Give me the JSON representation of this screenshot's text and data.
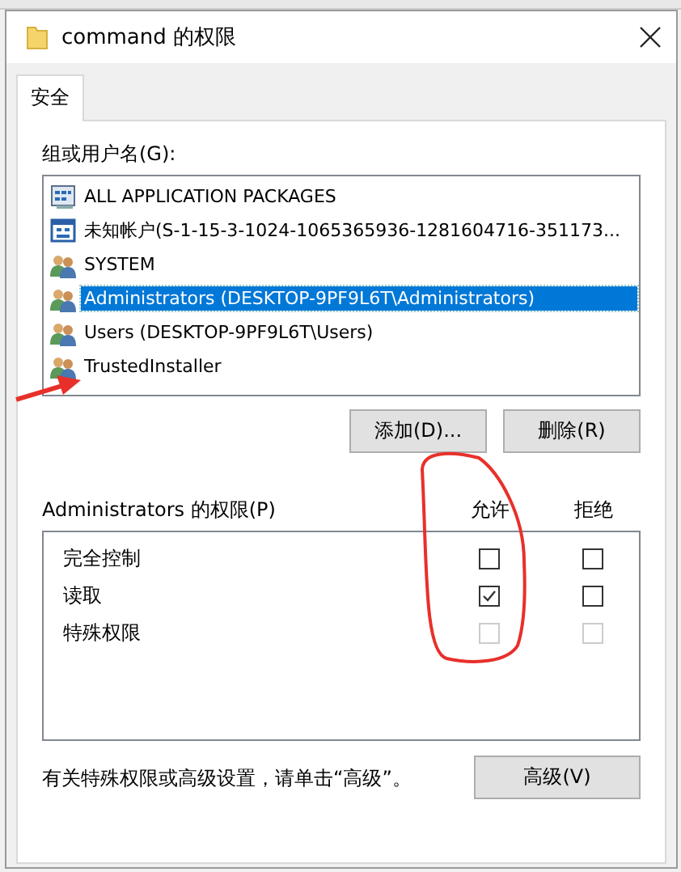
{
  "window": {
    "title": "command 的权限"
  },
  "tabs": [
    {
      "label": "安全",
      "selected": true
    }
  ],
  "users": {
    "label": "组或用户名(G):",
    "items": [
      {
        "name": "ALL APPLICATION PACKAGES",
        "kind": "packages",
        "selected": false
      },
      {
        "name": "未知帐户(S-1-15-3-1024-1065365936-1281604716-351173...",
        "kind": "account",
        "selected": false
      },
      {
        "name": "SYSTEM",
        "kind": "group",
        "selected": false
      },
      {
        "name": "Administrators (DESKTOP-9PF9L6T\\Administrators)",
        "kind": "group",
        "selected": true
      },
      {
        "name": "Users (DESKTOP-9PF9L6T\\Users)",
        "kind": "group",
        "selected": false
      },
      {
        "name": "TrustedInstaller",
        "kind": "group",
        "selected": false
      }
    ]
  },
  "buttons": [
    {
      "label": "添加(D)..."
    },
    {
      "label": "删除(R)"
    }
  ],
  "permissions": {
    "label": "Administrators 的权限(P)",
    "columns": [
      "允许",
      "拒绝"
    ],
    "rows": [
      {
        "name": "完全控制",
        "allow": {
          "checked": false,
          "disabled": false
        },
        "deny": {
          "checked": false,
          "disabled": false
        }
      },
      {
        "name": "读取",
        "allow": {
          "checked": true,
          "disabled": false
        },
        "deny": {
          "checked": false,
          "disabled": false
        }
      },
      {
        "name": "特殊权限",
        "allow": {
          "checked": false,
          "disabled": true
        },
        "deny": {
          "checked": false,
          "disabled": true
        }
      }
    ]
  },
  "note": "有关特殊权限或高级设置，请单击“高级”。",
  "advanced_button": "高级(V)"
}
